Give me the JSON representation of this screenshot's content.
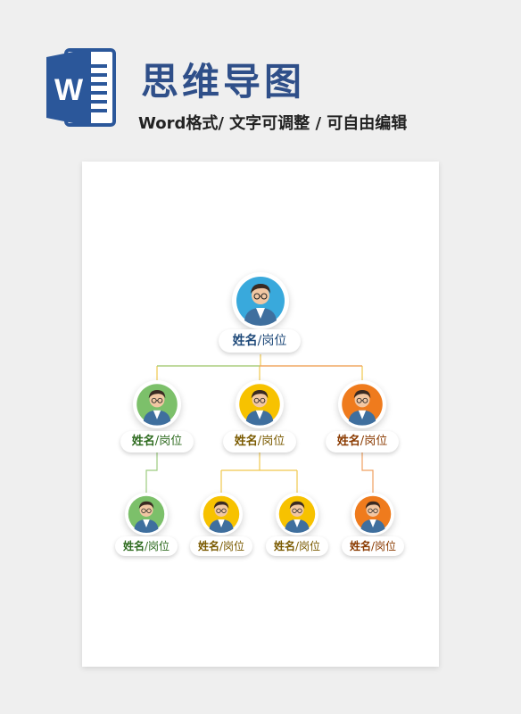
{
  "header": {
    "title": "思维导图",
    "subtitle": "Word格式/ 文字可调整 / 可自由编辑",
    "logo_letter": "W"
  },
  "colors": {
    "word_blue": "#2b579a",
    "title_blue": "#2f4f89",
    "root": "#39a9dc",
    "green": "#7cc06a",
    "yellow": "#f7c200",
    "orange": "#ef7b1d",
    "line_green": "#9ccc7f",
    "line_yellow": "#f0c84e",
    "line_orange": "#f0a060"
  },
  "nodes": [
    {
      "id": "root",
      "name": "姓名",
      "sep": "/",
      "role": "岗位",
      "color": "root",
      "text_color": "#1f4a7a"
    },
    {
      "id": "l1-1",
      "name": "姓名",
      "sep": "/",
      "role": "岗位",
      "color": "green",
      "text_color": "#2e6b1f"
    },
    {
      "id": "l1-2",
      "name": "姓名",
      "sep": "/",
      "role": "岗位",
      "color": "yellow",
      "text_color": "#7a5a00"
    },
    {
      "id": "l1-3",
      "name": "姓名",
      "sep": "/",
      "role": "岗位",
      "color": "orange",
      "text_color": "#8a3a00"
    },
    {
      "id": "l2-1",
      "name": "姓名",
      "sep": "/",
      "role": "岗位",
      "color": "green",
      "text_color": "#2e6b1f"
    },
    {
      "id": "l2-2",
      "name": "姓名",
      "sep": "/",
      "role": "岗位",
      "color": "yellow",
      "text_color": "#7a5a00"
    },
    {
      "id": "l2-3",
      "name": "姓名",
      "sep": "/",
      "role": "岗位",
      "color": "yellow",
      "text_color": "#7a5a00"
    },
    {
      "id": "l2-4",
      "name": "姓名",
      "sep": "/",
      "role": "岗位",
      "color": "orange",
      "text_color": "#8a3a00"
    }
  ]
}
